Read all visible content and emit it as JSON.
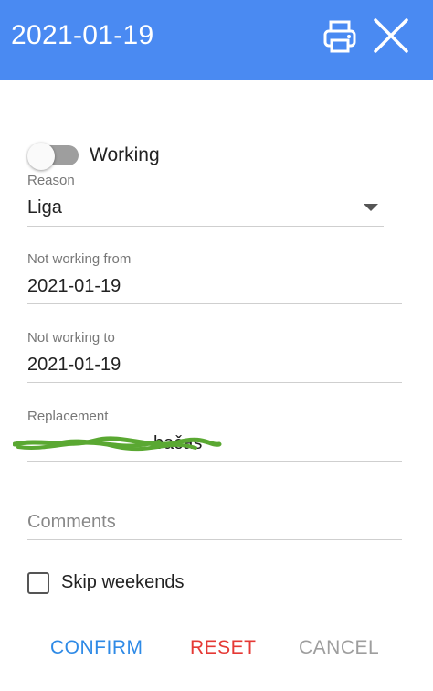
{
  "header": {
    "date": "2021-01-19",
    "print_icon": "printer-icon",
    "close_icon": "close-icon",
    "background": "#4a8af2"
  },
  "working_toggle": {
    "label": "Working",
    "checked": false
  },
  "reason": {
    "label": "Reason",
    "value": "Liga"
  },
  "not_working_from": {
    "label": "Not working from",
    "value": "2021-01-19"
  },
  "not_working_to": {
    "label": "Not working to",
    "value": "2021-01-19"
  },
  "replacement": {
    "label": "Replacement",
    "visible_fragment": "bačas",
    "scribble_color": "#5aa832"
  },
  "comments": {
    "placeholder": "Comments",
    "value": ""
  },
  "skip_weekends": {
    "label": "Skip weekends",
    "checked": false
  },
  "actions": {
    "confirm": "CONFIRM",
    "reset": "RESET",
    "cancel": "CANCEL",
    "confirm_color": "#2e8ae6",
    "reset_color": "#e53935",
    "cancel_color": "#9e9e9e"
  }
}
